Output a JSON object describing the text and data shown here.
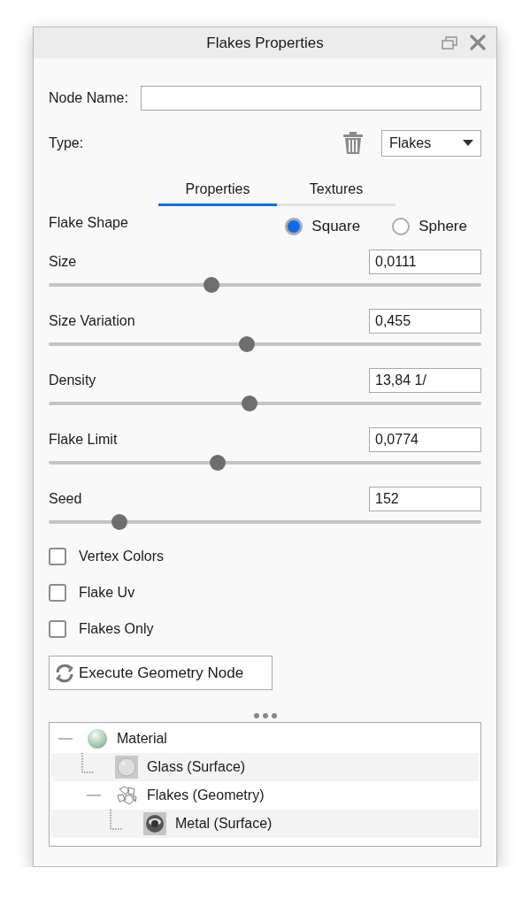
{
  "window": {
    "title": "Flakes Properties"
  },
  "node_name": {
    "label": "Node Name:"
  },
  "type": {
    "label": "Type:",
    "value": "Flakes"
  },
  "tabs": [
    {
      "label": "Properties",
      "selected": true
    },
    {
      "label": "Textures",
      "selected": false
    }
  ],
  "flake_shape": {
    "label": "Flake Shape",
    "options": [
      {
        "label": "Square",
        "selected": true
      },
      {
        "label": "Sphere",
        "selected": false
      }
    ]
  },
  "sliders": [
    {
      "label": "Size",
      "value": "0,0111",
      "level": 0.376
    },
    {
      "label": "Size Variation",
      "value": "0,455",
      "level": 0.459
    },
    {
      "label": "Density",
      "value": "13,84 1/",
      "level": 0.465
    },
    {
      "label": "Flake Limit",
      "value": "0,0774",
      "level": 0.39
    },
    {
      "label": "Seed",
      "value": "152",
      "level": 0.163
    }
  ],
  "checkboxes": [
    {
      "label": "Vertex Colors",
      "checked": false
    },
    {
      "label": "Flake Uv",
      "checked": false
    },
    {
      "label": "Flakes Only",
      "checked": false
    }
  ],
  "execute_button": {
    "label": "Execute Geometry Node"
  },
  "tree": [
    {
      "label": "Material",
      "kind": "material",
      "expanded": true,
      "children": [
        {
          "label": "Glass (Surface)",
          "kind": "glass"
        },
        {
          "label": "Flakes (Geometry)",
          "kind": "geometry",
          "expanded": true,
          "children": [
            {
              "label": "Metal (Surface)",
              "kind": "metal"
            }
          ]
        }
      ]
    }
  ]
}
